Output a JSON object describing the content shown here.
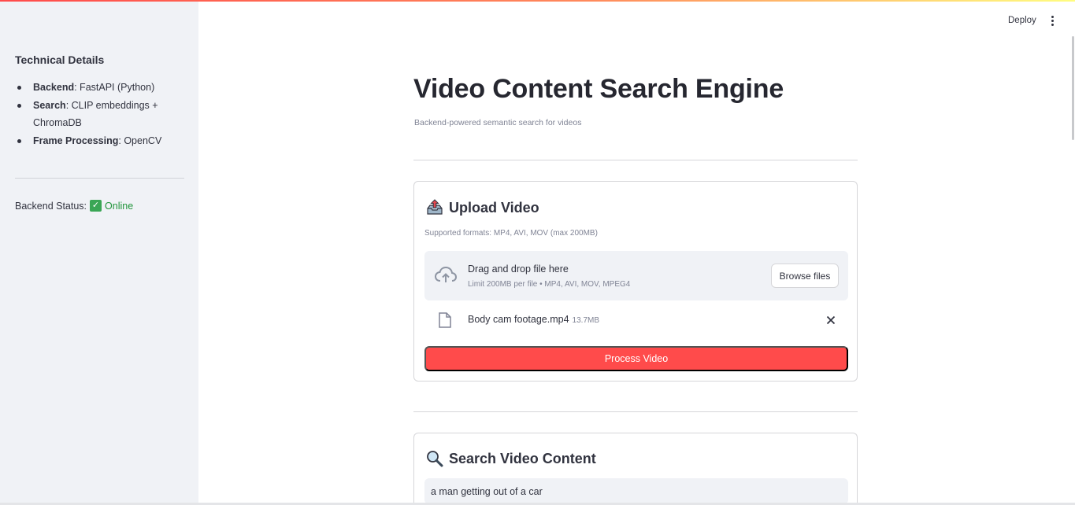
{
  "header": {
    "deploy_label": "Deploy",
    "menu_icon": "kebab-menu-icon"
  },
  "sidebar": {
    "heading": "Technical Details",
    "items": [
      {
        "term": "Backend",
        "desc": ": FastAPI (Python)"
      },
      {
        "term": "Search",
        "desc": ": CLIP embeddings + ChromaDB"
      },
      {
        "term": "Frame Processing",
        "desc": ": OpenCV"
      }
    ],
    "status_label": "Backend Status:",
    "status_icon": "check-mark-icon",
    "status_value": "Online",
    "status_color": "#21953b"
  },
  "main": {
    "title": "Video Content Search Engine",
    "caption": "Backend-powered semantic search for videos"
  },
  "upload": {
    "title": "Upload Video",
    "icon": "outbox-tray-icon",
    "caption": "Supported formats: MP4, AVI, MOV (max 200MB)",
    "dropzone_text": "Drag and drop file here",
    "dropzone_limit": "Limit 200MB per file • MP4, AVI, MOV, MPEG4",
    "browse_label": "Browse files",
    "file": {
      "name": "Body cam footage.mp4",
      "size": "13.7MB"
    },
    "process_label": "Process Video",
    "accent_color": "#ff4b4b"
  },
  "search": {
    "title": "Search Video Content",
    "icon": "magnifying-glass-icon",
    "query": "a man getting out of a car"
  }
}
